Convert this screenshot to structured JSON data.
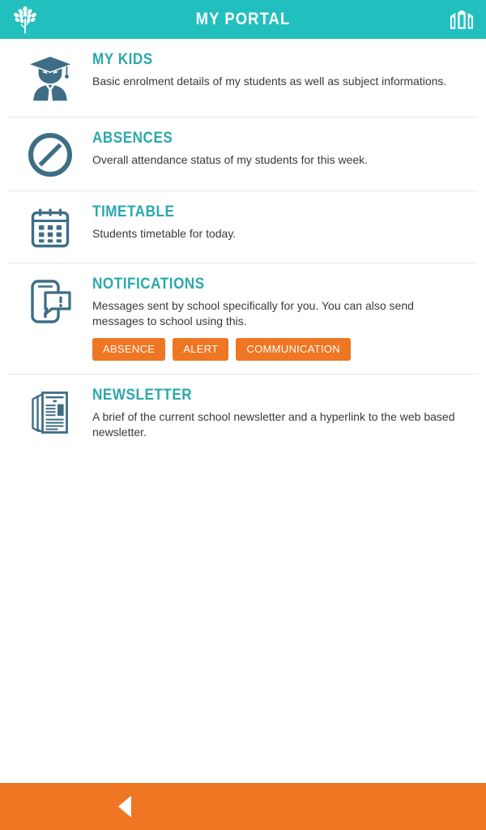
{
  "theme": {
    "header_bg": "#22bfbf",
    "accent_teal": "#2aa8ad",
    "icon_slate": "#3e6e86",
    "orange": "#ef7622",
    "text_dark": "#39393b",
    "divider": "#e6e6e6"
  },
  "header": {
    "title": "MY PORTAL",
    "logo_icon": "tree-icon",
    "right_icon": "school-building-icon"
  },
  "items": [
    {
      "icon": "graduate-student-icon",
      "title": "MY KIDS",
      "description": "Basic enrolment details of my students as well as subject informations.",
      "tags": []
    },
    {
      "icon": "prohibition-sign-icon",
      "title": "ABSENCES",
      "description": "Overall attendance status of my students for this week.",
      "tags": []
    },
    {
      "icon": "calendar-icon",
      "title": "TIMETABLE",
      "description": "Students timetable for today.",
      "tags": []
    },
    {
      "icon": "phone-alert-icon",
      "title": "NOTIFICATIONS",
      "description": "Messages sent by school specifically for you. You can also send messages to school using this.",
      "tags": [
        "ABSENCE",
        "ALERT",
        "COMMUNICATION"
      ]
    },
    {
      "icon": "newspaper-icon",
      "title": "NEWSLETTER",
      "description": "A brief of the current school newsletter and a hyperlink to the web based newsletter.",
      "tags": []
    }
  ],
  "footer": {
    "back_icon": "back-arrow-icon"
  }
}
